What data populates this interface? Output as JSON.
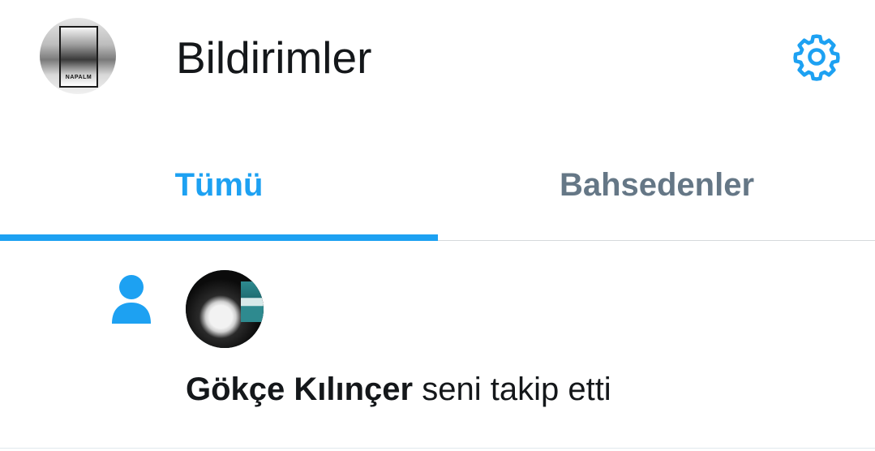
{
  "header": {
    "title": "Bildirimler",
    "profile_avatar_text": "NAPALM",
    "settings_icon": "gear-icon"
  },
  "tabs": [
    {
      "label": "Tümü",
      "active": true
    },
    {
      "label": "Bahsedenler",
      "active": false
    }
  ],
  "notifications": [
    {
      "type_icon": "person-icon",
      "user_name": "Gökçe Kılınçer",
      "action_text": " seni takip etti"
    }
  ],
  "colors": {
    "accent": "#1da1f2",
    "text_primary": "#14171a",
    "text_secondary": "#657786",
    "divider": "#d6d9db"
  }
}
